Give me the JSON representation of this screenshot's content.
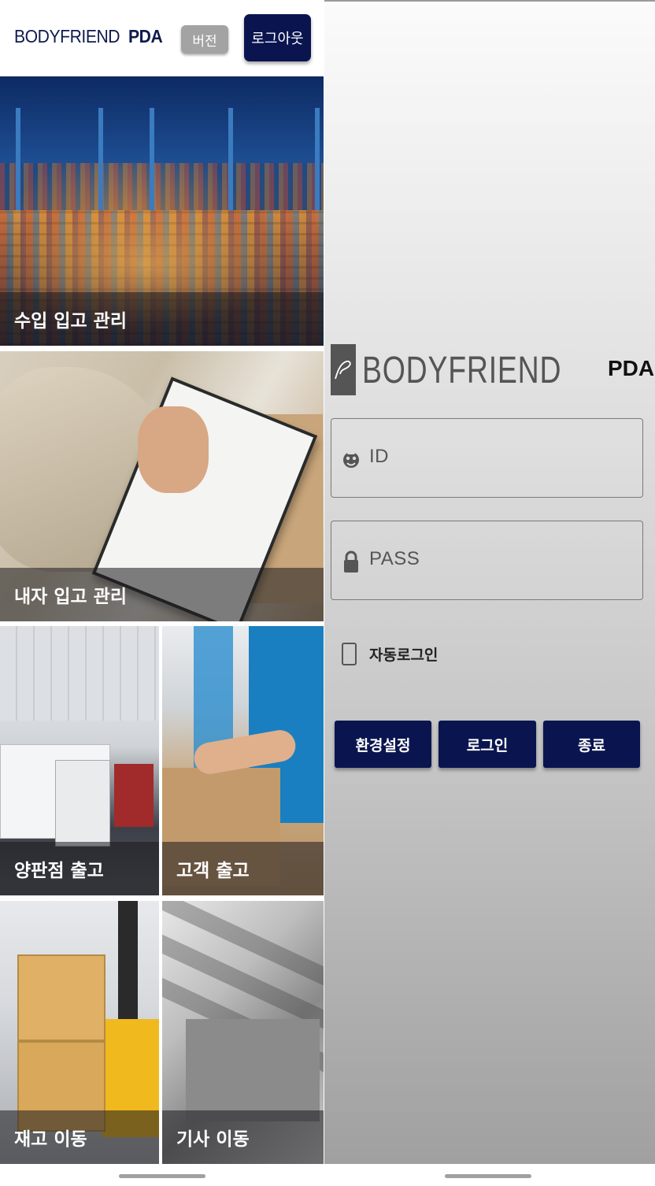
{
  "menu_screen": {
    "header": {
      "brand_main": "BODYFRIEND",
      "brand_suffix": "PDA",
      "version_button": "버전",
      "logout_button": "로그아웃"
    },
    "tiles": [
      {
        "label": "수입 입고 관리",
        "image": "container-port"
      },
      {
        "label": "내자 입고 관리",
        "image": "clipboard-box"
      },
      {
        "label": "양판점 출고",
        "image": "truck-dock"
      },
      {
        "label": "고객 출고",
        "image": "packing-boxes"
      },
      {
        "label": "재고 이동",
        "image": "forklift-boxes"
      },
      {
        "label": "기사 이동",
        "image": "moving-boxes"
      }
    ]
  },
  "login_screen": {
    "logo_text": "BODYFRIEND",
    "logo_suffix": "PDA",
    "id_placeholder": "ID",
    "pass_placeholder": "PASS",
    "id_icon": "user-face-icon",
    "pass_icon": "lock-icon",
    "auto_login_label": "자동로그인",
    "auto_login_checked": false,
    "buttons": {
      "settings": "환경설정",
      "login": "로그인",
      "exit": "종료"
    }
  },
  "colors": {
    "navy": "#0a1550",
    "version_gray": "#a3a3a3",
    "brand_text": "#0e1b4d"
  }
}
